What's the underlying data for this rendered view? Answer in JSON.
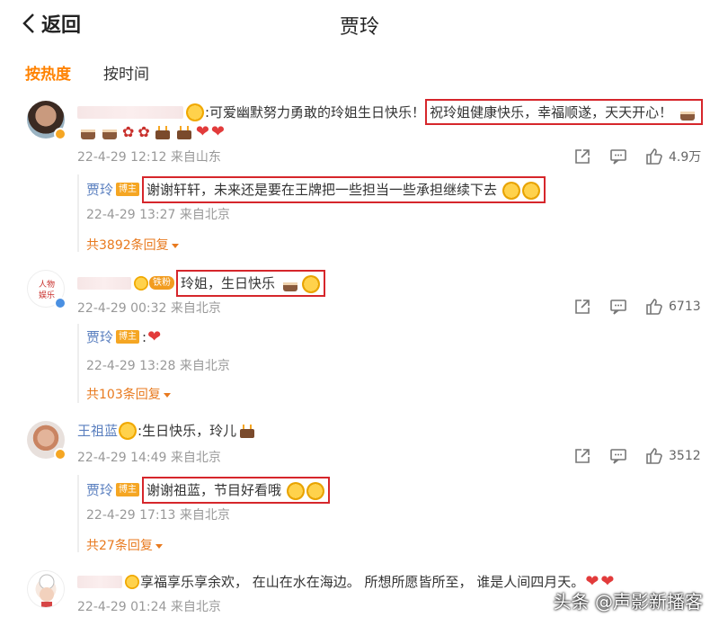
{
  "header": {
    "back_label": "返回",
    "title": "贾玲"
  },
  "tabs": {
    "hot": "按热度",
    "time": "按时间"
  },
  "comments": [
    {
      "text_prefix": ":可爱幽默努力勇敢的玲姐生日快乐！",
      "text_highlight": "祝玲姐健康快乐，幸福顺遂，天天开心！",
      "meta": "22-4-29 12:12 来自山东",
      "likes": "4.9万",
      "reply": {
        "name": "贾玲",
        "tag": "博主",
        "text": "谢谢轩轩，未来还是要在王牌把一些担当一些承担继续下去",
        "meta": "22-4-29 13:27 来自北京"
      },
      "more": "共3892条回复"
    },
    {
      "fan_tag": "铁粉",
      "text_highlight": "玲姐，生日快乐",
      "meta": "22-4-29 00:32 来自北京",
      "likes": "6713",
      "reply": {
        "name": "贾玲",
        "tag": "博主",
        "text": ":",
        "meta": "22-4-29 13:28 来自北京"
      },
      "more": "共103条回复"
    },
    {
      "name": "王祖蓝",
      "text": ":生日快乐，玲儿",
      "meta": "22-4-29 14:49 来自北京",
      "likes": "3512",
      "reply": {
        "name": "贾玲",
        "tag": "博主",
        "text": "谢谢祖蓝，节目好看哦",
        "meta": "22-4-29 17:13 来自北京"
      },
      "more": "共27条回复"
    },
    {
      "text": "享福享乐享余欢， 在山在水在海边。 所想所愿皆所至， 谁是人间四月天。",
      "meta": "22-4-29 01:24 来自北京"
    }
  ],
  "watermark": "头条 @声影新播客",
  "colors": {
    "accent": "#ff8200",
    "highlight_border": "#d6262b",
    "name_link": "#5a7fbf"
  }
}
